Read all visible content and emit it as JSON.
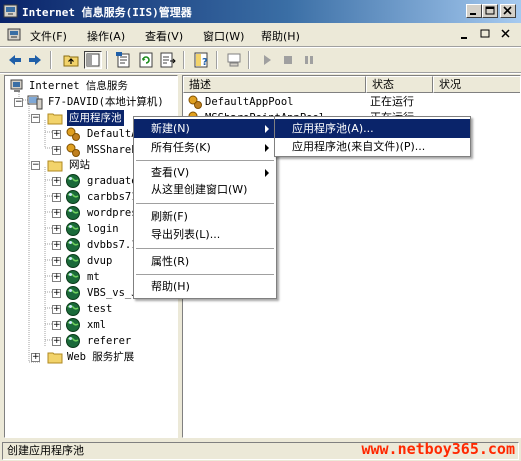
{
  "window": {
    "title": "Internet 信息服务(IIS)管理器"
  },
  "menubar": {
    "items": [
      "文件(F)",
      "操作(A)",
      "查看(V)",
      "窗口(W)",
      "帮助(H)"
    ]
  },
  "tree": {
    "root": "Internet 信息服务",
    "server": "F7-DAVID(本地计算机)",
    "app_pools": "应用程序池",
    "app_pool_children": [
      "DefaultA",
      "MSShareP"
    ],
    "websites": "网站",
    "sites": [
      "graduate",
      "carbbs71",
      "wordpres",
      "login",
      "dvbbs7.1",
      "dvup",
      "mt",
      "VBS_vs_J",
      "test",
      "xml",
      "referer"
    ],
    "web_ext": "Web 服务扩展"
  },
  "listview": {
    "columns": [
      "描述",
      "状态",
      "状况"
    ],
    "rows": [
      {
        "name": "DefaultAppPool",
        "status": "正在运行",
        "condition": ""
      },
      {
        "name": "MSSharePointAppPool",
        "status": "正在运行",
        "condition": ""
      }
    ]
  },
  "context_menu": {
    "items": [
      "新建(N)",
      "所有任务(K)",
      "查看(V)",
      "从这里创建窗口(W)",
      "刷新(F)",
      "导出列表(L)...",
      "属性(R)",
      "帮助(H)"
    ]
  },
  "submenu": {
    "items": [
      "应用程序池(A)...",
      "应用程序池(来自文件)(P)..."
    ]
  },
  "statusbar": {
    "text": "创建应用程序池"
  },
  "watermark": "www.netboy365.com",
  "colors": {
    "title_gradient_start": "#0a246a",
    "title_gradient_end": "#a6caf0",
    "selection": "#0a246a",
    "window_bg": "#ece9d8",
    "watermark": "#ff2800"
  }
}
